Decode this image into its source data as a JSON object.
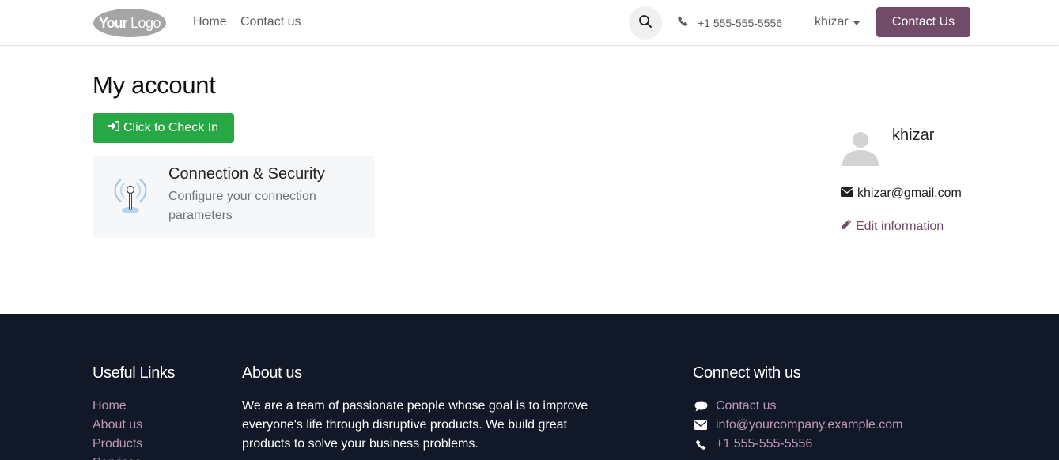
{
  "header": {
    "logo_text": "YourLogo",
    "nav": [
      {
        "label": "Home"
      },
      {
        "label": "Contact us"
      }
    ],
    "phone": "+1 555-555-5556",
    "user": "khizar",
    "contact_button": "Contact Us"
  },
  "main": {
    "title": "My account",
    "checkin_label": "Click to Check In",
    "card": {
      "title": "Connection & Security",
      "description": "Configure your connection parameters"
    },
    "profile": {
      "name": "khizar",
      "email": "khizar@gmail.com",
      "edit_label": "Edit information"
    }
  },
  "footer": {
    "useful_links": {
      "heading": "Useful Links",
      "items": [
        "Home",
        "About us",
        "Products",
        "Services"
      ]
    },
    "about": {
      "heading": "About us",
      "text": "We are a team of passionate people whose goal is to improve everyone's life through disruptive products. We build great products to solve your business problems."
    },
    "connect": {
      "heading": "Connect with us",
      "items": [
        {
          "icon": "comment-icon",
          "label": "Contact us"
        },
        {
          "icon": "envelope-icon",
          "label": "info@yourcompany.example.com"
        },
        {
          "icon": "phone-icon",
          "label": "+1 555-555-5556"
        }
      ]
    }
  },
  "colors": {
    "brand": "#714b67",
    "success": "#28a745",
    "footer_bg": "#111827",
    "footer_link": "#c197b7"
  }
}
